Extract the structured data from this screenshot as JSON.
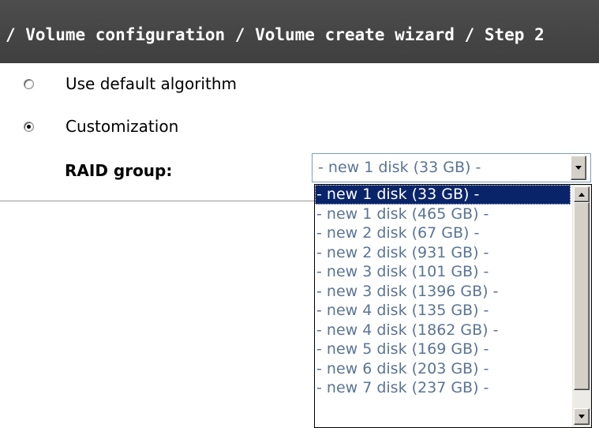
{
  "header": {
    "title": "/ Volume configuration / Volume create wizard / Step 2"
  },
  "options": [
    {
      "label": "Use default algorithm",
      "checked": false
    },
    {
      "label": "Customization",
      "checked": true
    }
  ],
  "raid_group": {
    "label": "RAID group:",
    "selected_value": "- new 1 disk (33 GB) -",
    "options": [
      "- new 1 disk (33 GB) -",
      "- new 1 disk (465 GB) -",
      "- new 2 disk (67 GB) -",
      "- new 2 disk (931 GB) -",
      "- new 3 disk (101 GB) -",
      "- new 3 disk (1396 GB) -",
      "- new 4 disk (135 GB) -",
      "- new 4 disk (1862 GB) -",
      "- new 5 disk (169 GB) -",
      "- new 6 disk (203 GB) -",
      "- new 7 disk (237 GB) -"
    ],
    "highlighted_index": 0
  },
  "colors": {
    "header_bg": "#434343",
    "option_text": "#5a7495",
    "highlight_bg": "#0a246a"
  }
}
